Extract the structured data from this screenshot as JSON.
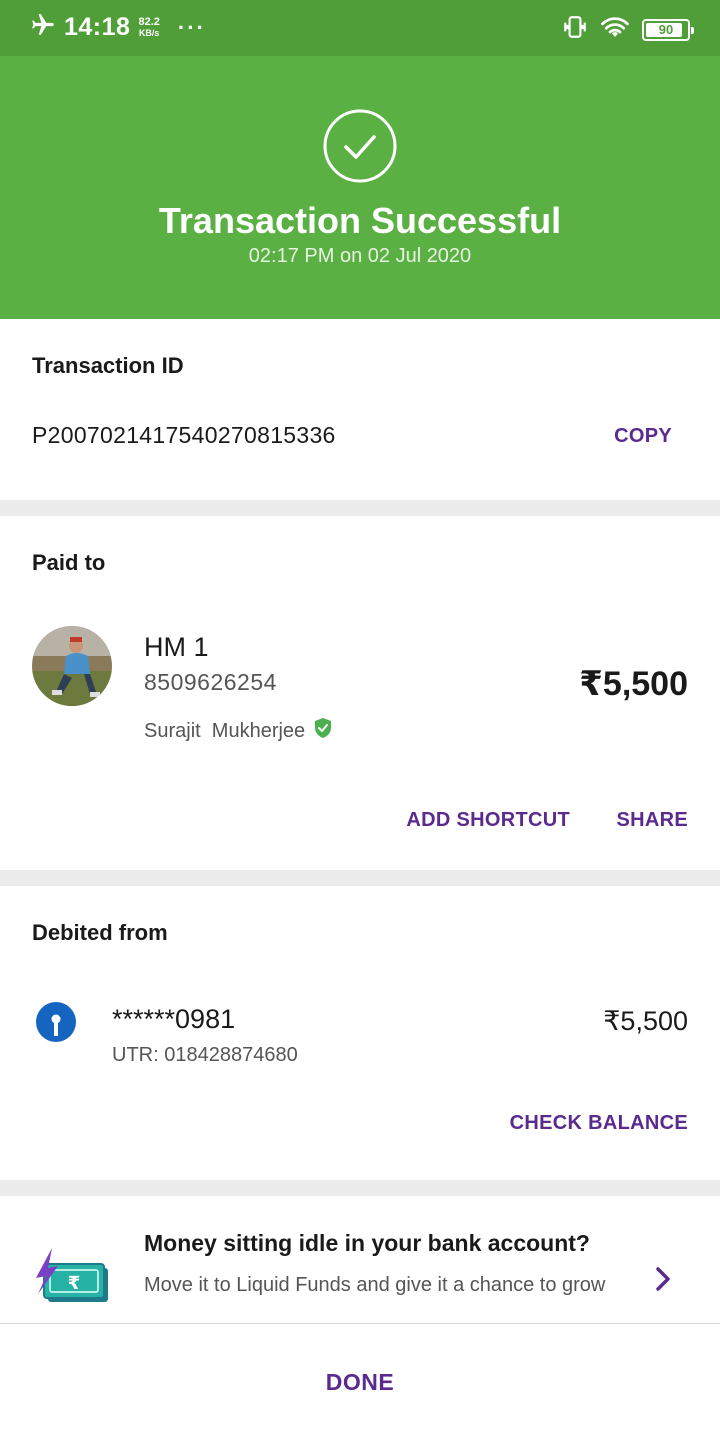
{
  "status_bar": {
    "time": "14:18",
    "speed_value": "82.2",
    "speed_unit": "KB/s",
    "more": "···",
    "battery": "90",
    "battery_level": 0.9,
    "icons": [
      "airplane-icon",
      "vibrate-icon",
      "wifi-icon",
      "battery-icon"
    ]
  },
  "hero": {
    "title": "Transaction Successful",
    "subtitle": "02:17 PM on 02 Jul 2020",
    "icon": "check-circle-icon"
  },
  "transaction": {
    "label": "Transaction ID",
    "id": "P2007021417540270815336",
    "copy_label": "COPY"
  },
  "paid_to": {
    "label": "Paid to",
    "name": "HM 1",
    "phone": "8509626254",
    "verified_name": "Surajit  Mukherjee",
    "amount": "₹5,500",
    "add_shortcut_label": "ADD SHORTCUT",
    "share_label": "SHARE"
  },
  "debited_from": {
    "label": "Debited from",
    "account": "******0981",
    "utr": "UTR: 018428874680",
    "amount": "₹5,500",
    "check_balance_label": "CHECK BALANCE"
  },
  "promo": {
    "title": "Money sitting idle in your bank account?",
    "description": "Move it to Liquid Funds and give it a chance to grow"
  },
  "footer": {
    "done_label": "DONE"
  },
  "colors": {
    "status_bar": "#4f9e38",
    "hero": "#5bb043",
    "accent": "#5a2a8f",
    "divider": "#ececec",
    "verified": "#4caf50",
    "bank": "#1565c0"
  }
}
